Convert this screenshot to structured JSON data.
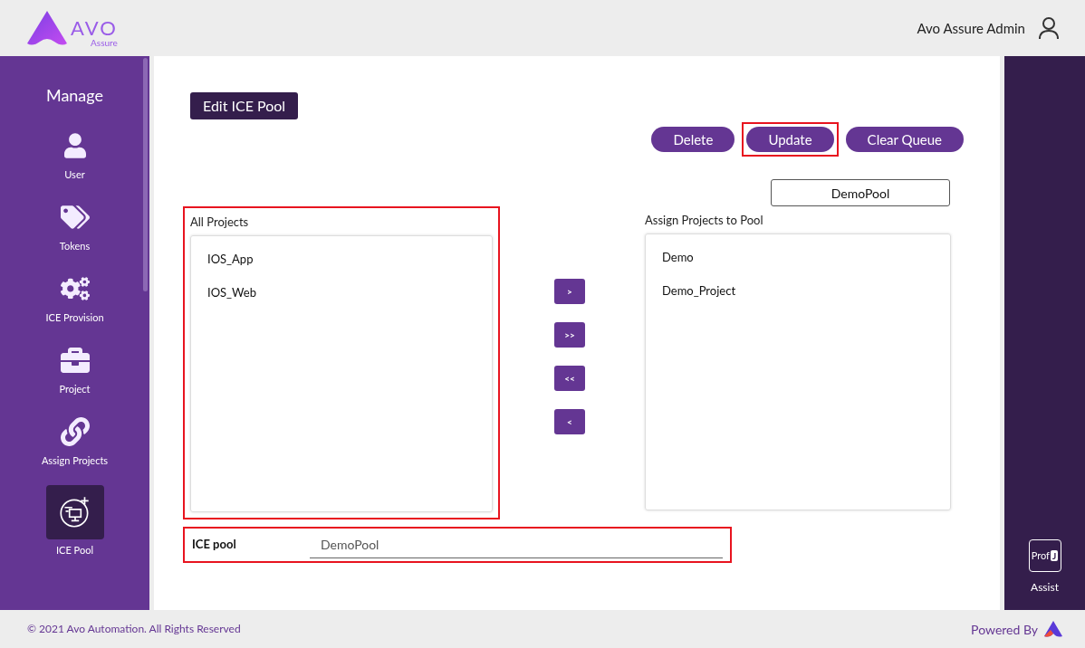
{
  "header": {
    "logo_text": "AVO",
    "logo_subtext": "Assure",
    "user_name": "Avo Assure Admin"
  },
  "sidebar": {
    "title": "Manage",
    "items": [
      {
        "label": "User",
        "kind": "user",
        "selected": false
      },
      {
        "label": "Tokens",
        "kind": "tags",
        "selected": false
      },
      {
        "label": "ICE Provision",
        "kind": "gears",
        "selected": false
      },
      {
        "label": "Project",
        "kind": "briefcase",
        "selected": false
      },
      {
        "label": "Assign Projects",
        "kind": "link",
        "selected": false
      },
      {
        "label": "ICE Pool",
        "kind": "pool",
        "selected": true
      }
    ]
  },
  "main": {
    "title": "Edit ICE Pool",
    "actions": [
      {
        "label": "Delete",
        "highlighted": false
      },
      {
        "label": "Update",
        "highlighted": true
      },
      {
        "label": "Clear Queue",
        "highlighted": false
      }
    ],
    "pool_name": "DemoPool",
    "all_projects": {
      "label": "All Projects",
      "items": [
        "IOS_App",
        "IOS_Web"
      ]
    },
    "assigned_projects": {
      "label": "Assign Projects to Pool",
      "items": [
        "Demo",
        "Demo_Project"
      ]
    },
    "move_buttons": [
      ">",
      ">>",
      "<<",
      "<"
    ],
    "ice_pool_field": {
      "label": "ICE pool",
      "value": "DemoPool"
    }
  },
  "right_panel": {
    "badge": "Prof",
    "badge_letter": "J",
    "label": "Assist"
  },
  "footer": {
    "copyright": "© 2021 Avo Automation. All Rights Reserved",
    "powered_by": "Powered By"
  }
}
